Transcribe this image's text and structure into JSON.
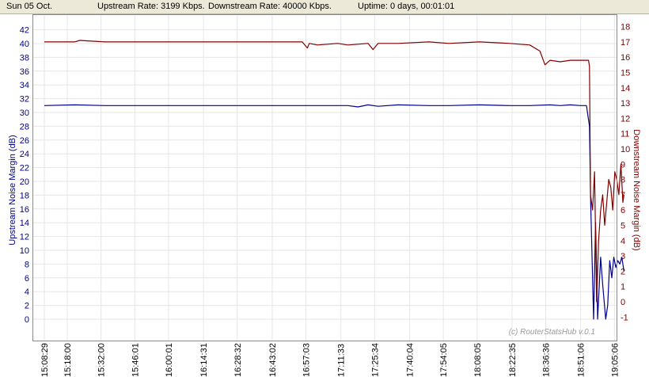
{
  "status": {
    "date": "Sun 05 Oct.",
    "upstream_rate": "Upstream Rate: 3199 Kbps.",
    "downstream_rate": "Downstream Rate: 40000 Kbps.",
    "uptime": "Uptime: 0 days, 00:01:01"
  },
  "watermark": "(c) RouterStatsHub v.0.1",
  "colors": {
    "upstream": "#00008b",
    "downstream": "#800000",
    "grid": "#e6e6e6"
  },
  "chart_data": {
    "type": "line",
    "title": "",
    "xlabel": "",
    "ylabel": "Upstream Noise Margin (dB)",
    "ylabel_right": "Downstream Noise Margin (dB)",
    "ylim": [
      -2,
      43
    ],
    "ylim_right": [
      -2.5,
      19
    ],
    "yticks": [
      0,
      2,
      4,
      6,
      8,
      10,
      12,
      14,
      16,
      18,
      20,
      22,
      24,
      26,
      28,
      30,
      32,
      34,
      36,
      38,
      40,
      42
    ],
    "yticks_right": [
      -1,
      0,
      1,
      2,
      3,
      4,
      5,
      6,
      7,
      8,
      9,
      10,
      11,
      12,
      13,
      14,
      15,
      16,
      17,
      18
    ],
    "grid": true,
    "x_ticks": [
      "15:08:29",
      "15:18:00",
      "15:32:00",
      "15:46:01",
      "16:00:01",
      "16:14:31",
      "16:28:32",
      "16:43:02",
      "16:57:03",
      "17:11:33",
      "17:25:34",
      "17:40:04",
      "17:54:05",
      "18:08:05",
      "18:22:35",
      "18:36:36",
      "18:51:06",
      "19:05:06"
    ],
    "x_tick_positions": [
      0.0,
      0.2273,
      0.5608,
      0.8945,
      1.2282,
      1.5737,
      1.9073,
      2.2529,
      2.5865,
      2.932,
      3.2656,
      3.6112,
      3.9448,
      4.2784,
      4.624,
      4.9576,
      5.3031,
      5.6367
    ],
    "series": [
      {
        "name": "Upstream Noise Margin",
        "axis": "left",
        "x": [
          0.0,
          0.3,
          0.6,
          1.0,
          1.5,
          2.0,
          2.5,
          3.0,
          3.1,
          3.2,
          3.3,
          3.5,
          3.8,
          4.0,
          4.3,
          4.6,
          4.8,
          5.0,
          5.1,
          5.2,
          5.3,
          5.36,
          5.39,
          5.4,
          5.41,
          5.43,
          5.45,
          5.47,
          5.49,
          5.5,
          5.52,
          5.55,
          5.57,
          5.59,
          5.61,
          5.63,
          5.65,
          5.67,
          5.69,
          5.71,
          5.73
        ],
        "values": [
          31.0,
          31.1,
          31.0,
          31.0,
          31.0,
          31.0,
          31.0,
          31.0,
          30.8,
          31.1,
          30.9,
          31.1,
          31.0,
          31.0,
          31.1,
          31.0,
          31.0,
          31.1,
          31.0,
          31.1,
          31.0,
          31.0,
          28.0,
          18.0,
          12.0,
          0.0,
          14.0,
          0.0,
          6.0,
          9.0,
          5.0,
          0.0,
          2.0,
          8.5,
          6.0,
          9.0,
          7.5,
          8.5,
          8.0,
          9.0,
          7.0
        ]
      },
      {
        "name": "Downstream Noise Margin",
        "axis": "right",
        "x": [
          0.0,
          0.3,
          0.35,
          0.6,
          1.0,
          1.5,
          2.0,
          2.55,
          2.6,
          2.62,
          2.7,
          2.9,
          3.0,
          3.2,
          3.25,
          3.3,
          3.5,
          3.8,
          4.0,
          4.3,
          4.6,
          4.8,
          4.9,
          4.95,
          5.0,
          5.1,
          5.2,
          5.3,
          5.38,
          5.39,
          5.4,
          5.42,
          5.44,
          5.46,
          5.48,
          5.5,
          5.52,
          5.54,
          5.56,
          5.58,
          5.6,
          5.62,
          5.64,
          5.66,
          5.68,
          5.7,
          5.72,
          5.73
        ],
        "values": [
          17.0,
          17.0,
          17.1,
          17.0,
          17.0,
          17.0,
          17.0,
          17.0,
          16.6,
          16.9,
          16.8,
          16.9,
          16.8,
          16.9,
          16.5,
          16.9,
          16.9,
          17.0,
          16.9,
          17.0,
          16.9,
          16.8,
          16.4,
          15.5,
          15.8,
          15.7,
          15.8,
          15.8,
          15.8,
          15.4,
          7.0,
          6.0,
          8.5,
          0.0,
          4.0,
          6.0,
          7.0,
          5.0,
          6.5,
          8.0,
          7.5,
          6.0,
          8.5,
          8.0,
          7.0,
          9.0,
          6.5,
          7.0
        ]
      }
    ]
  }
}
